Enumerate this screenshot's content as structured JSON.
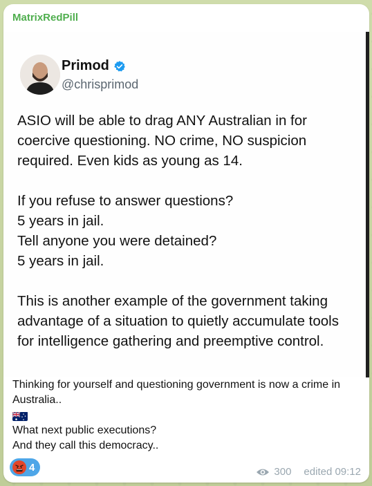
{
  "message": {
    "sender": "MatrixRedPill",
    "caption_lines": [
      "Thinking for yourself and questioning government is now a crime in Australia..",
      "What next public executions?",
      "And they call this democracy.."
    ],
    "caption_flag": "australia-flag-emoji",
    "reaction": {
      "emoji": "angry-face-emoji",
      "count": "4"
    },
    "views": "300",
    "edited_time": "edited 09:12"
  },
  "tweet_image": {
    "author_name": "Primod",
    "author_handle": "@chrisprimod",
    "verified_icon": "verified-badge-icon",
    "paragraphs": [
      "ASIO will be able to drag ANY Australian in for coercive questioning. NO crime, NO suspicion required. Even kids as young as 14.",
      "If you refuse to answer questions?\n5 years in jail.\nTell anyone you were detained?\n5 years in jail.",
      "This is another example of the government taking advantage of a situation to quietly accumulate tools for intelligence gathering and preemptive control."
    ]
  },
  "colors": {
    "sender": "#4fae4e",
    "reaction_bg": "#4ea6e8",
    "meta_text": "#9aa7b0",
    "verified": "#1d9bf0"
  }
}
